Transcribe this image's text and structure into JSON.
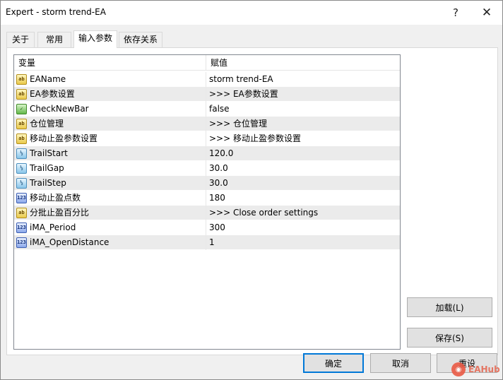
{
  "window": {
    "title": "Expert - storm trend-EA",
    "help_glyph": "?",
    "close_glyph": "✕"
  },
  "tabs": [
    {
      "label": "关于",
      "active": false
    },
    {
      "label": "常用",
      "active": false
    },
    {
      "label": "输入参数",
      "active": true
    },
    {
      "label": "依存关系",
      "active": false
    }
  ],
  "grid": {
    "col_variable": "变量",
    "col_value": "赋值",
    "rows": [
      {
        "icon": "string-icon",
        "type": "ab",
        "name": "EAName",
        "value": "storm trend-EA"
      },
      {
        "icon": "string-icon",
        "type": "ab",
        "name": "EA参数设置",
        "value": ">>> EA参数设置"
      },
      {
        "icon": "bool-icon",
        "type": "bool",
        "name": "CheckNewBar",
        "value": "false"
      },
      {
        "icon": "string-icon",
        "type": "ab",
        "name": "仓位管理",
        "value": ">>> 仓位管理"
      },
      {
        "icon": "string-icon",
        "type": "ab",
        "name": "移动止盈参数设置",
        "value": ">>> 移动止盈参数设置"
      },
      {
        "icon": "double-icon",
        "type": "dbl",
        "name": "TrailStart",
        "value": "120.0"
      },
      {
        "icon": "double-icon",
        "type": "dbl",
        "name": "TrailGap",
        "value": "30.0"
      },
      {
        "icon": "double-icon",
        "type": "dbl",
        "name": "TrailStep",
        "value": "30.0"
      },
      {
        "icon": "integer-icon",
        "type": "int",
        "name": "移动止盈点数",
        "value": "180"
      },
      {
        "icon": "string-icon",
        "type": "ab",
        "name": "分批止盈百分比",
        "value": ">>> Close order settings"
      },
      {
        "icon": "integer-icon",
        "type": "int",
        "name": "iMA_Period",
        "value": "300"
      },
      {
        "icon": "integer-icon",
        "type": "int",
        "name": "iMA_OpenDistance",
        "value": "1"
      }
    ]
  },
  "icon_glyphs": {
    "ab": "ab",
    "bool": "✓",
    "dbl": "½",
    "int": "123"
  },
  "buttons": {
    "load": "加载(L)",
    "save": "保存(S)",
    "ok": "确定",
    "cancel": "取消",
    "reset": "重设"
  },
  "watermark": {
    "text": "EAHub"
  },
  "colors": {
    "focus_border": "#0078d7",
    "row_alt": "#ebebeb"
  }
}
